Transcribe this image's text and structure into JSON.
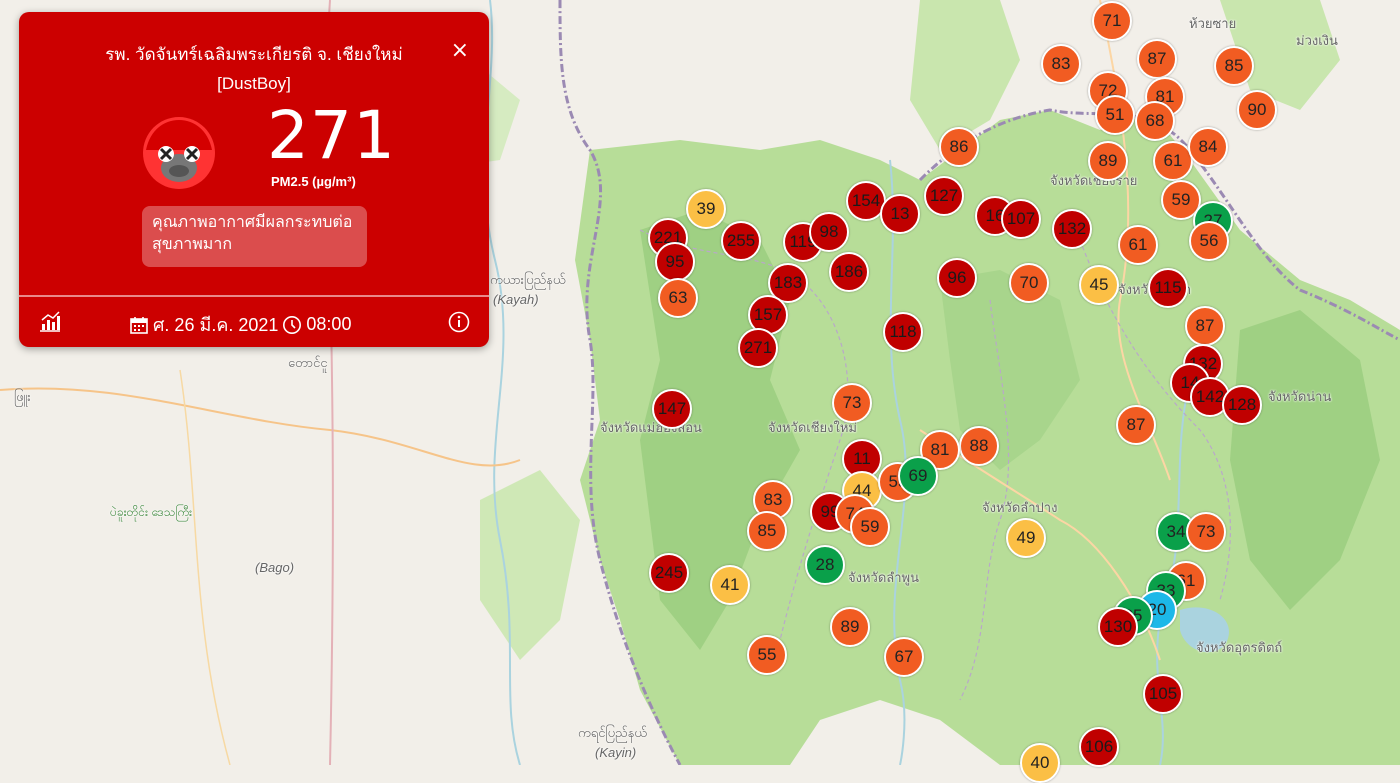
{
  "popup": {
    "title_line1": "รพ. วัดจันทร์เฉลิมพระเกียรติ จ. เชียงใหม่",
    "title_line2": "[DustBoy]",
    "close": "×",
    "value": "271",
    "unit": "PM2.5 (µg/m³)",
    "level_text": "คุณภาพอากาศมีผลกระทบต่อสุขภาพมาก",
    "date": "ศ. 26 มี.ค. 2021",
    "time": "08:00",
    "icons": [
      "chart-icon",
      "calendar-icon",
      "clock-icon",
      "info-icon"
    ]
  },
  "colors": {
    "very_unhealthy": "#c00000",
    "unhealthy": "#f15c22",
    "moderate": "#fbbf45",
    "good": "#0aa04a",
    "very_good": "#1cb8e8",
    "popup_bg": "#cc0000"
  },
  "map_labels": [
    {
      "id": "kayah",
      "text": "ကယားပြည်နယ်"
    },
    {
      "id": "kayah_en",
      "text": "(Kayah)"
    },
    {
      "id": "taungoo",
      "text": "တောင်ငူ"
    },
    {
      "id": "pyu",
      "text": "ဖြူး"
    },
    {
      "id": "bago_region",
      "text": "ပဲခူးတိုင်း ဒေသကြီး"
    },
    {
      "id": "bago_en",
      "text": "(Bago)"
    },
    {
      "id": "kayin",
      "text": "ကရင်ပြည်နယ်"
    },
    {
      "id": "kayin_en",
      "text": "(Kayin)"
    },
    {
      "id": "mae_hong_son",
      "text": "จังหวัดแม่ฮ่องสอน"
    },
    {
      "id": "chiang_mai",
      "text": "จังหวัดเชียงใหม่"
    },
    {
      "id": "lamphun",
      "text": "จังหวัดลำพูน"
    },
    {
      "id": "lampang",
      "text": "จังหวัดลำปาง"
    },
    {
      "id": "nan",
      "text": "จังหวัดน่าน"
    },
    {
      "id": "uttaradit",
      "text": "จังหวัดอุตรดิตถ์"
    },
    {
      "id": "chiang_rai",
      "text": "จังหวัดเชียงราย"
    },
    {
      "id": "phayao",
      "text": "จังหวัดพะเยา"
    },
    {
      "id": "huai_sai",
      "text": "ห้วยซาย"
    },
    {
      "id": "muang_houn",
      "text": "ม่วงเงิน"
    }
  ],
  "markers": [
    {
      "v": 71,
      "c": "unhealthy"
    },
    {
      "v": 87,
      "c": "unhealthy"
    },
    {
      "v": 83,
      "c": "unhealthy"
    },
    {
      "v": 85,
      "c": "unhealthy"
    },
    {
      "v": 72,
      "c": "unhealthy"
    },
    {
      "v": 81,
      "c": "unhealthy"
    },
    {
      "v": 90,
      "c": "unhealthy"
    },
    {
      "v": 51,
      "c": "unhealthy"
    },
    {
      "v": 68,
      "c": "unhealthy"
    },
    {
      "v": 86,
      "c": "unhealthy"
    },
    {
      "v": 89,
      "c": "unhealthy"
    },
    {
      "v": 61,
      "c": "unhealthy"
    },
    {
      "v": 84,
      "c": "unhealthy"
    },
    {
      "v": 59,
      "c": "unhealthy"
    },
    {
      "v": 39,
      "c": "moderate"
    },
    {
      "v": 154,
      "c": "very_unhealthy"
    },
    {
      "v": 127,
      "c": "very_unhealthy"
    },
    {
      "v": 13,
      "c": "very_unhealthy"
    },
    {
      "v": 16,
      "c": "very_unhealthy"
    },
    {
      "v": 107,
      "c": "very_unhealthy"
    },
    {
      "v": 132,
      "c": "very_unhealthy"
    },
    {
      "v": 27,
      "c": "good"
    },
    {
      "v": 221,
      "c": "very_unhealthy"
    },
    {
      "v": 255,
      "c": "very_unhealthy"
    },
    {
      "v": 119,
      "c": "very_unhealthy"
    },
    {
      "v": 98,
      "c": "very_unhealthy"
    },
    {
      "v": 61,
      "c": "unhealthy"
    },
    {
      "v": 56,
      "c": "unhealthy"
    },
    {
      "v": 95,
      "c": "very_unhealthy"
    },
    {
      "v": 186,
      "c": "very_unhealthy"
    },
    {
      "v": 183,
      "c": "very_unhealthy"
    },
    {
      "v": 96,
      "c": "very_unhealthy"
    },
    {
      "v": 70,
      "c": "unhealthy"
    },
    {
      "v": 45,
      "c": "moderate"
    },
    {
      "v": 115,
      "c": "very_unhealthy"
    },
    {
      "v": 63,
      "c": "unhealthy"
    },
    {
      "v": 157,
      "c": "very_unhealthy"
    },
    {
      "v": 118,
      "c": "very_unhealthy"
    },
    {
      "v": 87,
      "c": "unhealthy"
    },
    {
      "v": 271,
      "c": "very_unhealthy"
    },
    {
      "v": 132,
      "c": "very_unhealthy"
    },
    {
      "v": 14,
      "c": "very_unhealthy"
    },
    {
      "v": 142,
      "c": "very_unhealthy"
    },
    {
      "v": 128,
      "c": "very_unhealthy"
    },
    {
      "v": 147,
      "c": "very_unhealthy"
    },
    {
      "v": 73,
      "c": "unhealthy"
    },
    {
      "v": 87,
      "c": "unhealthy"
    },
    {
      "v": 88,
      "c": "unhealthy"
    },
    {
      "v": 81,
      "c": "unhealthy"
    },
    {
      "v": 11,
      "c": "very_unhealthy"
    },
    {
      "v": 44,
      "c": "moderate"
    },
    {
      "v": 55,
      "c": "unhealthy"
    },
    {
      "v": 69,
      "c": "good"
    },
    {
      "v": 83,
      "c": "unhealthy"
    },
    {
      "v": 99,
      "c": "very_unhealthy"
    },
    {
      "v": 74,
      "c": "unhealthy"
    },
    {
      "v": 59,
      "c": "unhealthy"
    },
    {
      "v": 85,
      "c": "unhealthy"
    },
    {
      "v": 49,
      "c": "moderate"
    },
    {
      "v": 34,
      "c": "good"
    },
    {
      "v": 73,
      "c": "unhealthy"
    },
    {
      "v": 28,
      "c": "good"
    },
    {
      "v": 245,
      "c": "very_unhealthy"
    },
    {
      "v": 41,
      "c": "moderate"
    },
    {
      "v": 61,
      "c": "unhealthy"
    },
    {
      "v": 33,
      "c": "good"
    },
    {
      "v": 20,
      "c": "very_good"
    },
    {
      "v": 35,
      "c": "good"
    },
    {
      "v": 130,
      "c": "very_unhealthy"
    },
    {
      "v": 89,
      "c": "unhealthy"
    },
    {
      "v": 67,
      "c": "unhealthy"
    },
    {
      "v": 55,
      "c": "unhealthy"
    },
    {
      "v": 105,
      "c": "very_unhealthy"
    },
    {
      "v": 106,
      "c": "very_unhealthy"
    },
    {
      "v": 40,
      "c": "moderate"
    }
  ]
}
